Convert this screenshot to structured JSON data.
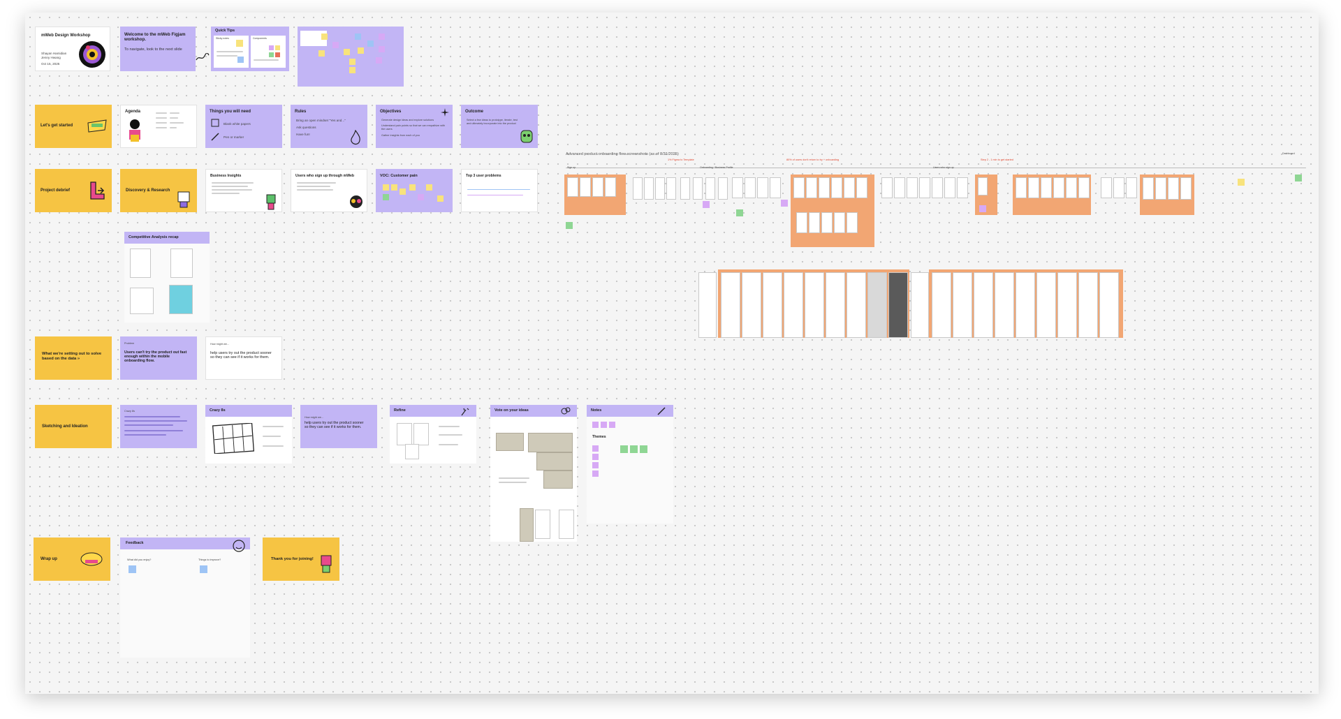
{
  "workshop": {
    "title": "mWeb Design Workshop",
    "authors": [
      "Shayan Hamidian",
      "Jenny Hwang"
    ],
    "date": "Oct 15, 2025"
  },
  "welcome": {
    "title": "Welcome to the mWeb Figjam workshop.",
    "subtitle": "To navigate, look to the next slide"
  },
  "quick_tips": {
    "title": "Quick Tips",
    "sections": [
      "Sticky notes",
      "Components"
    ]
  },
  "row2": {
    "lets_get_started": "Let's get started",
    "agenda": "Agenda",
    "things": "Things you will need",
    "things_items": [
      "Blank white papers",
      "Pen or marker"
    ],
    "rules": "Rules",
    "rules_items": [
      "Bring an open mindset \"Yes and...\"",
      "Ask questions",
      "Have fun!"
    ],
    "objectives": "Objectives",
    "objectives_items": [
      "Generate design ideas and explore solutions",
      "Understand pain points so that we can empathize with the users",
      "Gather insights from each of you"
    ],
    "outcome": "Outcome",
    "outcome_text": "Select a few ideas to prototype, iterate, test and ultimately incorporate into the product"
  },
  "row3": {
    "project_debrief": "Project debrief",
    "discovery": "Discovery & Research",
    "business_insights": "Business Insights",
    "users_signup": "Users who sign up through mWeb",
    "voc": "VOC: Customer pain",
    "top3": "Top 3 user problems"
  },
  "competitive": {
    "title": "Competitive Analysis recap"
  },
  "row4": {
    "setting_out": "What we're setting out to solve based on the data »",
    "problem_label": "Problem",
    "problem": "Users can't try the product out fast enough within the mobile onboarding flow.",
    "hmw_label": "How might we...",
    "hmw": "help users try out the product sooner so they can see if it works for them."
  },
  "row5": {
    "sketching": "Sketching and Ideation",
    "crazy8_intro_title": "Crazy 8s",
    "crazy8_title": "Crazy 8s",
    "hmw_label": "How might we...",
    "hmw_text": "help users try out the product sooner so they can see if it works for them.",
    "refine": "Refine",
    "vote": "Vote on your ideas",
    "notes": "Notes",
    "themes": "Themes"
  },
  "row6": {
    "wrap_up": "Wrap up",
    "feedback": "Feedback",
    "q1": "What did you enjoy?",
    "q2": "Things to improve?",
    "thanks": "Thank you for joining!"
  },
  "flow": {
    "title": "Advanced product onboarding flow screenshots (as of 8/31/2025)",
    "annotations": [
      "1% Figma to Template",
      "80% of users don't return to try + onboarding",
      "Step 2 - 1 min to get started"
    ],
    "labels": [
      "Sign up",
      "Onboarding / Business Profile",
      "Users who sign up",
      "Dashboard"
    ]
  },
  "colors": {
    "board_bg": "#f5f5f5",
    "purple": "#c2b5f5",
    "yellow": "#f6c443",
    "orange": "#f2a673",
    "annotation_red": "#e0452d"
  }
}
